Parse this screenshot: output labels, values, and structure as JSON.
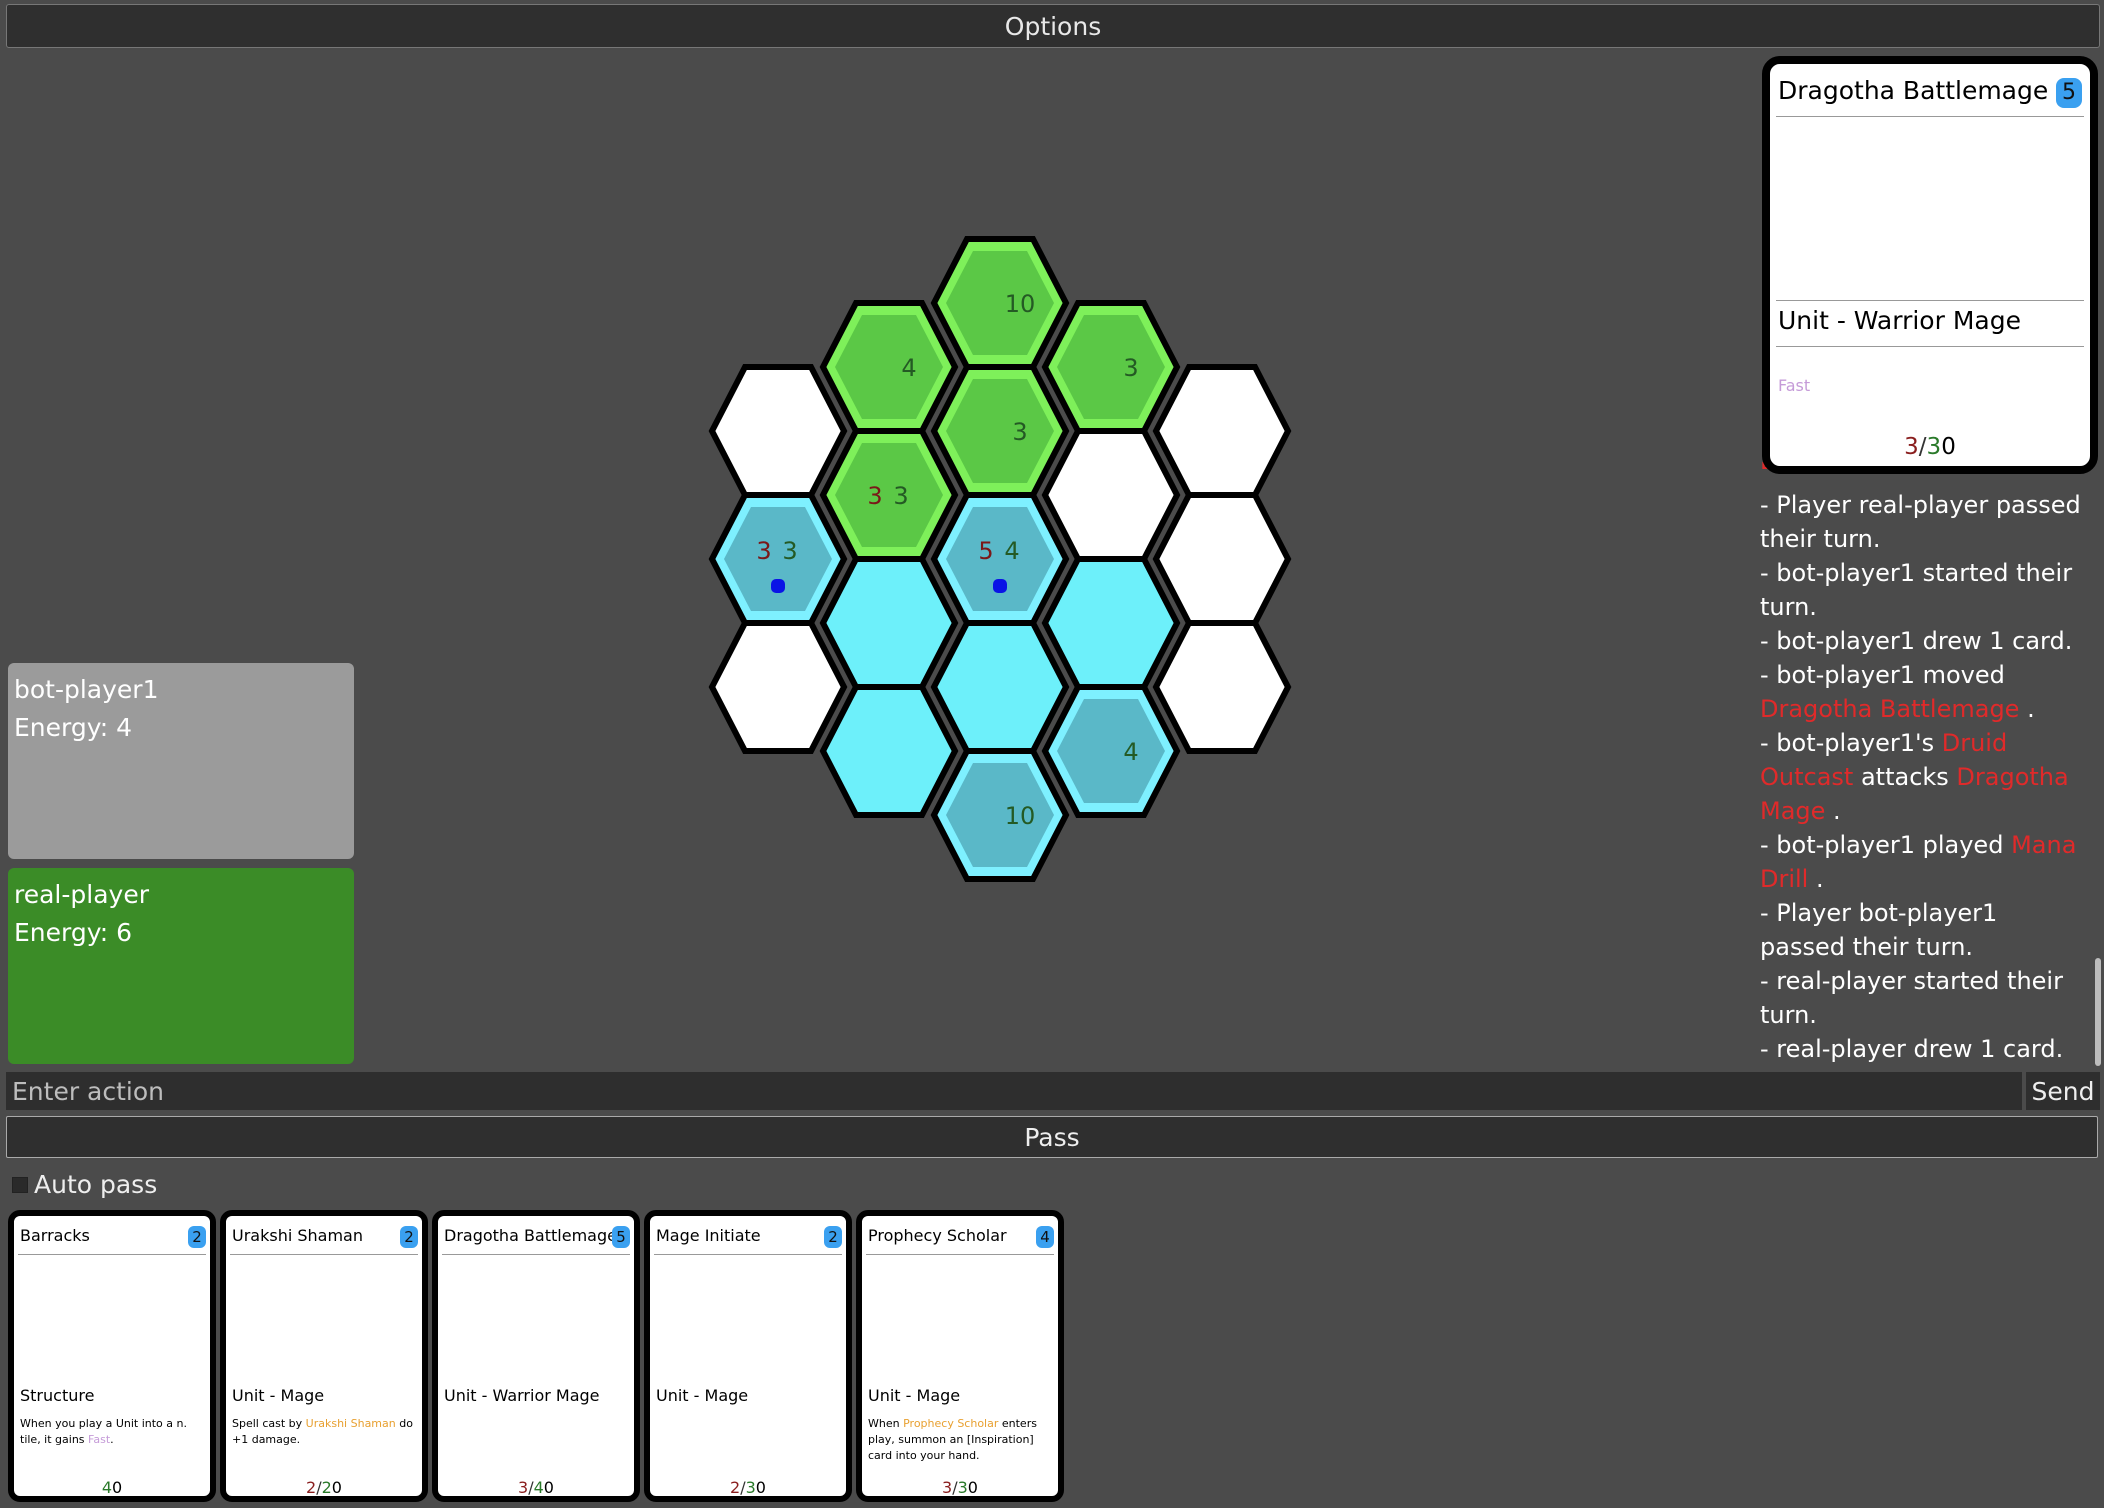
{
  "topbar": {
    "label": "Options"
  },
  "players": [
    {
      "name": "bot-player1",
      "energy_label": "Energy: 4"
    },
    {
      "name": "real-player",
      "energy_label": "Energy: 6"
    }
  ],
  "colors": {
    "green_tile": "#5bc846",
    "green_border": "#7ef05a",
    "cyan_tile": "#5ab8c8",
    "cyan_border": "#7ef0ff",
    "cyan_empty": "#6df0fa",
    "white_tile": "#ffffff",
    "bot_panel": "#9b9b9b",
    "real_panel": "#3b8c27",
    "card_ref": "#e02a2a",
    "cost_badge": "#3aa0f0"
  },
  "board": {
    "tiles": [
      {
        "id": "c1r0",
        "kind": "white"
      },
      {
        "id": "c1r1",
        "kind": "cyan-unit",
        "atk": "3",
        "hp": "3",
        "dot": true
      },
      {
        "id": "c1r2",
        "kind": "white"
      },
      {
        "id": "c2r0",
        "kind": "green-unit",
        "hp": "4"
      },
      {
        "id": "c2r1",
        "kind": "green-unit",
        "atk": "3",
        "hp": "3"
      },
      {
        "id": "c2r2",
        "kind": "cyan"
      },
      {
        "id": "c2r3",
        "kind": "cyan"
      },
      {
        "id": "c3r0",
        "kind": "green-unit",
        "hp": "10"
      },
      {
        "id": "c3r1",
        "kind": "green-unit",
        "hp": "3"
      },
      {
        "id": "c3r2",
        "kind": "cyan-unit",
        "atk": "5",
        "hp": "4",
        "dot": true
      },
      {
        "id": "c3r3",
        "kind": "cyan"
      },
      {
        "id": "c3r4",
        "kind": "cyan-unit",
        "hp": "10"
      },
      {
        "id": "c4r0",
        "kind": "green-unit",
        "hp": "3"
      },
      {
        "id": "c4r1",
        "kind": "white"
      },
      {
        "id": "c4r2",
        "kind": "cyan"
      },
      {
        "id": "c4r3",
        "kind": "cyan-unit",
        "hp": "4"
      },
      {
        "id": "c5r0",
        "kind": "white"
      },
      {
        "id": "c5r1",
        "kind": "white"
      },
      {
        "id": "c5r2",
        "kind": "white"
      }
    ]
  },
  "preview": {
    "name": "Dragotha Battlemage",
    "cost": "5",
    "type": "Unit - Warrior Mage",
    "keyword": "Fast",
    "atk": "3",
    "slash": "/",
    "hp": "3",
    "extra": "0"
  },
  "log": {
    "cut_line": "Dragotha Battlemage",
    "entries": [
      {
        "text": "- Player real-player passed their turn."
      },
      {
        "text": "- bot-player1 started their turn."
      },
      {
        "text": "- bot-player1 drew 1 card."
      },
      {
        "text": "- bot-player1 moved ",
        "ref": "Dragotha Battlemage",
        "tail": " ."
      },
      {
        "text": "- bot-player1's ",
        "ref": "Druid Outcast",
        "mid": " attacks ",
        "ref2": "Dragotha Mage",
        "tail": " ."
      },
      {
        "text": "- bot-player1 played ",
        "ref": "Mana Drill",
        "tail": " ."
      },
      {
        "text": "- Player bot-player1 passed their turn."
      },
      {
        "text": "- real-player started their turn."
      },
      {
        "text": "- real-player drew 1 card."
      }
    ]
  },
  "action_input": {
    "placeholder": "Enter action"
  },
  "send_label": "Send",
  "pass_label": "Pass",
  "auto_pass_label": "Auto pass",
  "hand": [
    {
      "name": "Barracks",
      "cost": "2",
      "type": "Structure",
      "text_pre": "When you play a Unit into a n. tile, it gains ",
      "text_kw": "Fast",
      "text_post": ".",
      "kw_class": "kw-fast",
      "atk": "",
      "slash": "",
      "hp": "4",
      "extra": "0"
    },
    {
      "name": "Urakshi Shaman",
      "cost": "2",
      "type": "Unit - Mage",
      "text_pre": "Spell cast by ",
      "text_kw": "Urakshi Shaman",
      "text_post": " do +1 damage.",
      "kw_class": "kw-orange",
      "atk": "2",
      "slash": "/",
      "hp": "2",
      "extra": "0"
    },
    {
      "name": "Dragotha Battlemage",
      "cost": "5",
      "type": "Unit - Warrior Mage",
      "text_pre": "",
      "text_kw": "",
      "text_post": "",
      "kw_class": "kw-orange",
      "atk": "3",
      "slash": "/",
      "hp": "4",
      "extra": "0"
    },
    {
      "name": "Mage Initiate",
      "cost": "2",
      "type": "Unit - Mage",
      "text_pre": "",
      "text_kw": "",
      "text_post": "",
      "kw_class": "kw-orange",
      "atk": "2",
      "slash": "/",
      "hp": "3",
      "extra": "0"
    },
    {
      "name": "Prophecy Scholar",
      "cost": "4",
      "type": "Unit - Mage",
      "text_pre": "When ",
      "text_kw": "Prophecy Scholar",
      "text_post": " enters play, summon an [Inspiration] card into your hand.",
      "kw_class": "kw-orange",
      "atk": "3",
      "slash": "/",
      "hp": "3",
      "extra": "0"
    }
  ]
}
